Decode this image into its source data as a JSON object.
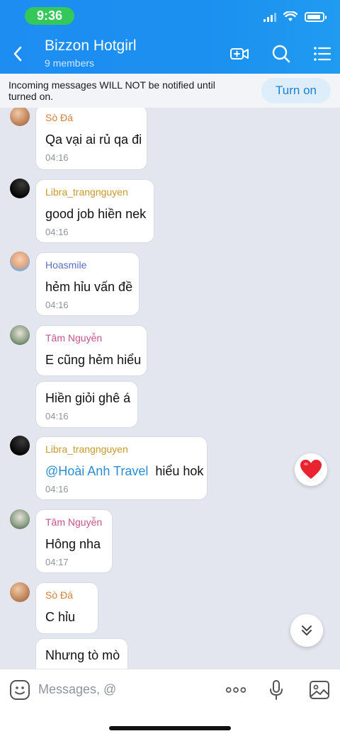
{
  "status_bar": {
    "time": "9:36"
  },
  "header": {
    "title": "Bizzon Hotgirl",
    "members": "9 members"
  },
  "notice": {
    "text": "Incoming messages WILL NOT be notified until turned on.",
    "button": "Turn on"
  },
  "messages": [
    {
      "sender": "Sò Đá",
      "text": "Qa vại ai rủ qa đi",
      "time": "04:16"
    },
    {
      "sender": "Libra_trangnguyen",
      "text": "good job hiền nek",
      "time": "04:16"
    },
    {
      "sender": "Hoasmile",
      "text": "hẻm hỉu vấn đề",
      "time": "04:16"
    },
    {
      "sender": "Tâm Nguyễn",
      "text": "E cũng hẻm hiểu",
      "time": ""
    },
    {
      "sender": "",
      "text": "Hiền giỏi ghê á",
      "time": "04:16"
    },
    {
      "sender": "Libra_trangnguyen",
      "mention": "@Hoài Anh Travel",
      "text": "hiểu hok",
      "time": "04:16"
    },
    {
      "sender": "Tâm Nguyễn",
      "text": "Hông nha",
      "time": "04:17"
    },
    {
      "sender": "Sò Đá",
      "text": "C hỉu",
      "time": ""
    },
    {
      "sender": "",
      "text": "Nhưng tò mò",
      "time": ""
    }
  ],
  "input": {
    "placeholder": "Messages, @"
  },
  "colors": {
    "header": "#1e8df2",
    "sender_so_da": "#d2813a",
    "sender_libra": "#c89a2a",
    "sender_hoasmile": "#5b6ec7",
    "sender_tam": "#c6538c",
    "heart": "#e8232f"
  }
}
